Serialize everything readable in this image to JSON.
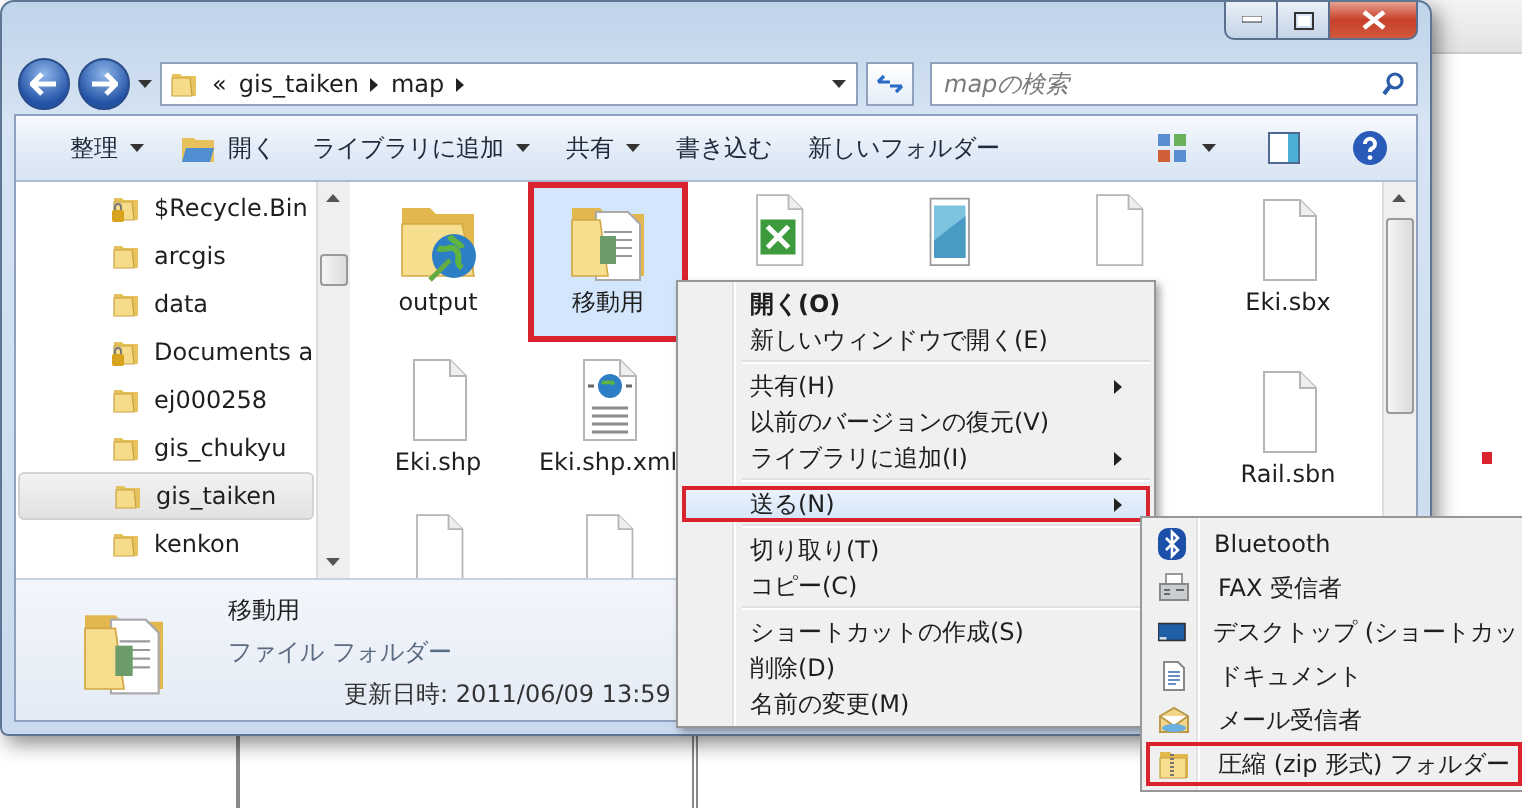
{
  "address": {
    "overflow": "«",
    "path": [
      "gis_taiken",
      "map"
    ]
  },
  "search": {
    "placeholder": "mapの検索"
  },
  "toolbar": [
    {
      "label": "整理",
      "kind": "plain",
      "dropdown": true
    },
    {
      "label": "開く",
      "kind": "with_icon",
      "dropdown": false
    },
    {
      "label": "ライブラリに追加",
      "kind": "plain",
      "dropdown": true
    },
    {
      "label": "共有",
      "kind": "plain",
      "dropdown": true
    },
    {
      "label": "書き込む",
      "kind": "plain",
      "dropdown": false
    },
    {
      "label": "新しいフォルダー",
      "kind": "plain",
      "dropdown": false
    }
  ],
  "sidebar": {
    "items": [
      {
        "label": "$Recycle.Bin",
        "locked": true,
        "selected": false
      },
      {
        "label": "arcgis",
        "locked": false,
        "selected": false
      },
      {
        "label": "data",
        "locked": false,
        "selected": false
      },
      {
        "label": "Documents a",
        "locked": true,
        "selected": false
      },
      {
        "label": "ej000258",
        "locked": false,
        "selected": false
      },
      {
        "label": "gis_chukyu",
        "locked": false,
        "selected": false
      },
      {
        "label": "gis_taiken",
        "locked": false,
        "selected": true
      },
      {
        "label": "kenkon",
        "locked": false,
        "selected": false
      }
    ]
  },
  "files": {
    "grid": [
      [
        {
          "label": "output",
          "kind": "globe-folder",
          "selected": false,
          "highlighted": false
        },
        {
          "label": "移動用",
          "kind": "docs-folder",
          "selected": true,
          "highlighted": true
        },
        {
          "kind": "excel",
          "selected": false,
          "highlighted": false
        },
        {
          "kind": "notepad",
          "selected": false,
          "highlighted": false
        },
        {
          "kind": "blank",
          "selected": false,
          "highlighted": false
        }
      ],
      [
        {
          "label": "Eki.shp",
          "kind": "blank",
          "selected": false,
          "highlighted": false
        },
        {
          "label": "Eki.shp.xml",
          "kind": "xml",
          "selected": false,
          "highlighted": false
        }
      ],
      [
        {
          "kind": "blank",
          "selected": false,
          "highlighted": false
        },
        {
          "kind": "blank",
          "selected": false,
          "highlighted": false
        }
      ]
    ],
    "right_column": [
      {
        "label": "Eki.sbx",
        "kind": "blank",
        "selected": false,
        "highlighted": false
      },
      {
        "label": "Rail.sbn",
        "kind": "blank",
        "selected": false,
        "highlighted": false
      }
    ]
  },
  "details": {
    "name": "移動用",
    "type": "ファイル フォルダー",
    "modified": "更新日時: 2011/06/09 13:59"
  },
  "context_menu": {
    "items": [
      {
        "kind": "item",
        "label": "開く(O)",
        "default": true,
        "submenu": false,
        "selected": false,
        "highlighted": false
      },
      {
        "kind": "item",
        "label": "新しいウィンドウで開く(E)",
        "default": false,
        "submenu": false,
        "selected": false,
        "highlighted": false
      },
      {
        "kind": "separator"
      },
      {
        "kind": "item",
        "label": "共有(H)",
        "default": false,
        "submenu": true,
        "selected": false,
        "highlighted": false
      },
      {
        "kind": "item",
        "label": "以前のバージョンの復元(V)",
        "default": false,
        "submenu": false,
        "selected": false,
        "highlighted": false
      },
      {
        "kind": "item",
        "label": "ライブラリに追加(I)",
        "default": false,
        "submenu": true,
        "selected": false,
        "highlighted": false
      },
      {
        "kind": "separator"
      },
      {
        "kind": "item",
        "label": "送る(N)",
        "default": false,
        "submenu": true,
        "selected": true,
        "highlighted": true
      },
      {
        "kind": "separator"
      },
      {
        "kind": "item",
        "label": "切り取り(T)",
        "default": false,
        "submenu": false,
        "selected": false,
        "highlighted": false
      },
      {
        "kind": "item",
        "label": "コピー(C)",
        "default": false,
        "submenu": false,
        "selected": false,
        "highlighted": false
      },
      {
        "kind": "separator"
      },
      {
        "kind": "item",
        "label": "ショートカットの作成(S)",
        "default": false,
        "submenu": false,
        "selected": false,
        "highlighted": false
      },
      {
        "kind": "item",
        "label": "削除(D)",
        "default": false,
        "submenu": false,
        "selected": false,
        "highlighted": false
      },
      {
        "kind": "item",
        "label": "名前の変更(M)",
        "default": false,
        "submenu": false,
        "selected": false,
        "highlighted": false
      }
    ]
  },
  "send_to_menu": {
    "items": [
      {
        "kind": "bluetooth",
        "label": "Bluetooth",
        "highlighted": false
      },
      {
        "kind": "fax",
        "label": "FAX 受信者",
        "highlighted": false
      },
      {
        "kind": "desktop",
        "label": "デスクトップ (ショートカッ",
        "highlighted": false
      },
      {
        "kind": "document",
        "label": "ドキュメント",
        "highlighted": false
      },
      {
        "kind": "mail",
        "label": "メール受信者",
        "highlighted": false
      },
      {
        "kind": "zip",
        "label": "圧縮 (zip 形式) フォルダー",
        "highlighted": true
      }
    ]
  }
}
